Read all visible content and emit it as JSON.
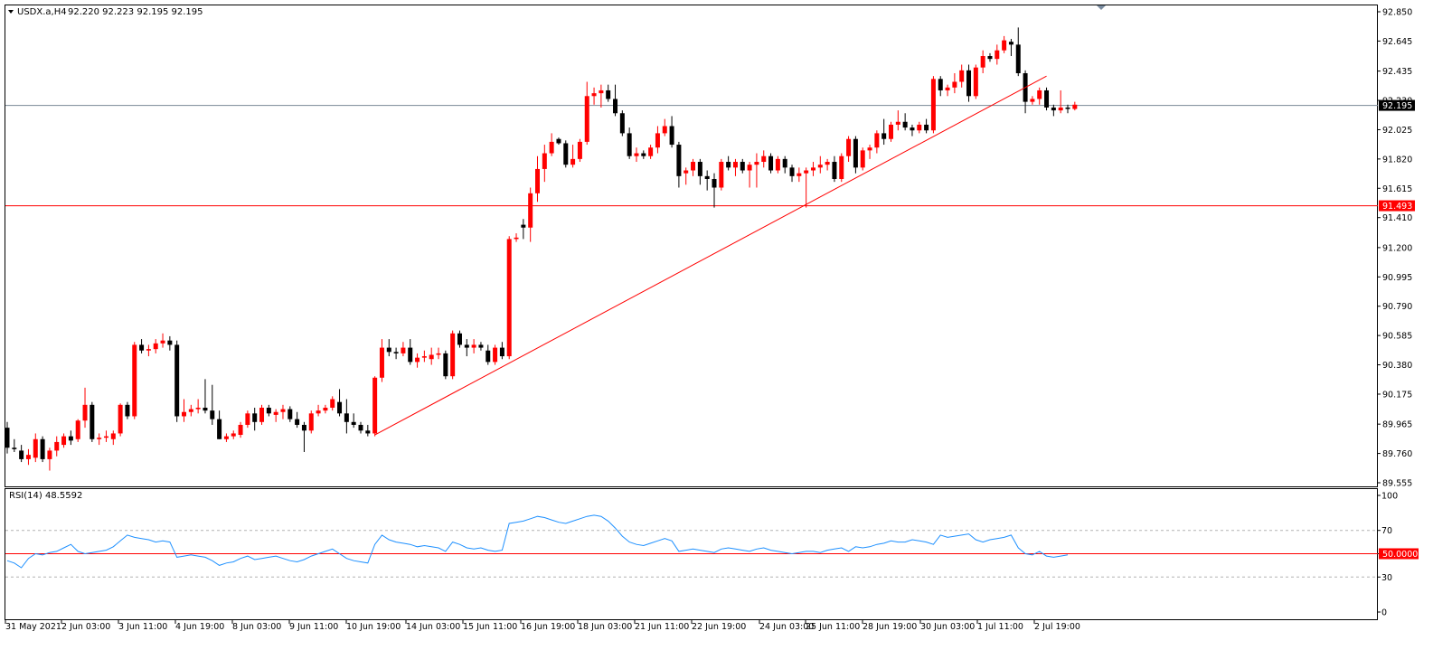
{
  "header": {
    "symbol_label": "USDX.a,H4",
    "ohlc": "92.220 92.223 92.195 92.195"
  },
  "rsi_header": {
    "label": "RSI(14) 48.5592"
  },
  "colors": {
    "bull": "#ff0000",
    "bear": "#000000",
    "trend": "#ff0000",
    "support": "#ff0000",
    "rsi_line": "#1e90ff",
    "rsi_level": "#ff0000",
    "bid_line": "#7a8896",
    "grid_dash": "#b4b4b4"
  },
  "chart_data": [
    {
      "type": "candlestick",
      "symbol": "USDX.a",
      "timeframe": "H4",
      "ylim": [
        89.555,
        92.85
      ],
      "y_ticks": [
        "92.850",
        "92.645",
        "92.435",
        "92.230",
        "92.025",
        "91.820",
        "91.615",
        "91.410",
        "91.200",
        "90.995",
        "90.790",
        "90.585",
        "90.380",
        "90.175",
        "89.965",
        "89.760",
        "89.555"
      ],
      "x_labels": [
        "31 May 2021",
        "2 Jun 03:00",
        "3 Jun 11:00",
        "4 Jun 19:00",
        "8 Jun 03:00",
        "9 Jun 11:00",
        "10 Jun 19:00",
        "14 Jun 03:00",
        "15 Jun 11:00",
        "16 Jun 19:00",
        "18 Jun 03:00",
        "21 Jun 11:00",
        "22 Jun 19:00",
        "24 Jun 03:00",
        "25 Jun 11:00",
        "28 Jun 19:00",
        "30 Jun 03:00",
        "1 Jul 11:00",
        "2 Jul 19:00"
      ],
      "current_price": "92.195",
      "support_level": "91.493",
      "ohlc": [
        [
          89.94,
          89.98,
          89.76,
          89.8
        ],
        [
          89.8,
          89.86,
          89.77,
          89.79
        ],
        [
          89.78,
          89.82,
          89.7,
          89.72
        ],
        [
          89.72,
          89.79,
          89.68,
          89.75
        ],
        [
          89.73,
          89.9,
          89.7,
          89.86
        ],
        [
          89.86,
          89.88,
          89.7,
          89.72
        ],
        [
          89.72,
          89.8,
          89.64,
          89.78
        ],
        [
          89.78,
          89.88,
          89.74,
          89.84
        ],
        [
          89.82,
          89.9,
          89.8,
          89.88
        ],
        [
          89.88,
          89.92,
          89.82,
          89.85
        ],
        [
          89.86,
          90.0,
          89.84,
          89.99
        ],
        [
          89.99,
          90.22,
          89.94,
          90.1
        ],
        [
          90.1,
          90.12,
          89.84,
          89.86
        ],
        [
          89.86,
          89.9,
          89.82,
          89.87
        ],
        [
          89.87,
          89.92,
          89.84,
          89.88
        ],
        [
          89.86,
          89.92,
          89.82,
          89.9
        ],
        [
          89.9,
          90.11,
          89.88,
          90.1
        ],
        [
          90.1,
          90.12,
          90.0,
          90.02
        ],
        [
          90.02,
          90.54,
          90.0,
          90.52
        ],
        [
          90.52,
          90.56,
          90.46,
          90.48
        ],
        [
          90.48,
          90.52,
          90.44,
          90.49
        ],
        [
          90.49,
          90.56,
          90.46,
          90.53
        ],
        [
          90.53,
          90.6,
          90.5,
          90.55
        ],
        [
          90.55,
          90.58,
          90.48,
          90.52
        ],
        [
          90.52,
          90.55,
          89.98,
          90.02
        ],
        [
          90.02,
          90.14,
          89.98,
          90.05
        ],
        [
          90.05,
          90.1,
          90.02,
          90.07
        ],
        [
          90.07,
          90.14,
          90.04,
          90.08
        ],
        [
          90.08,
          90.28,
          90.04,
          90.06
        ],
        [
          90.06,
          90.24,
          89.96,
          90.0
        ],
        [
          90.0,
          90.06,
          89.86,
          89.86
        ],
        [
          89.86,
          89.9,
          89.84,
          89.88
        ],
        [
          89.88,
          89.92,
          89.86,
          89.9
        ],
        [
          89.89,
          89.98,
          89.87,
          89.96
        ],
        [
          89.96,
          90.06,
          89.94,
          90.04
        ],
        [
          90.04,
          90.08,
          89.92,
          89.98
        ],
        [
          89.98,
          90.1,
          89.96,
          90.08
        ],
        [
          90.08,
          90.1,
          90.02,
          90.04
        ],
        [
          90.03,
          90.07,
          89.98,
          90.05
        ],
        [
          90.05,
          90.1,
          90.0,
          90.07
        ],
        [
          90.07,
          90.09,
          89.98,
          90.0
        ],
        [
          90.0,
          90.05,
          89.94,
          89.96
        ],
        [
          89.96,
          89.98,
          89.77,
          89.92
        ],
        [
          89.92,
          90.06,
          89.9,
          90.04
        ],
        [
          90.04,
          90.1,
          90.02,
          90.06
        ],
        [
          90.06,
          90.1,
          90.04,
          90.08
        ],
        [
          90.08,
          90.16,
          90.06,
          90.14
        ],
        [
          90.12,
          90.21,
          90.02,
          90.04
        ],
        [
          90.04,
          90.14,
          89.9,
          89.98
        ],
        [
          89.98,
          90.04,
          89.94,
          89.96
        ],
        [
          89.96,
          89.98,
          89.9,
          89.92
        ],
        [
          89.92,
          89.96,
          89.88,
          89.9
        ],
        [
          89.9,
          90.3,
          89.88,
          90.29
        ],
        [
          90.29,
          90.56,
          90.26,
          90.5
        ],
        [
          90.5,
          90.56,
          90.44,
          90.47
        ],
        [
          90.47,
          90.5,
          90.42,
          90.46
        ],
        [
          90.46,
          90.54,
          90.44,
          90.5
        ],
        [
          90.5,
          90.56,
          90.38,
          90.4
        ],
        [
          90.4,
          90.46,
          90.36,
          90.43
        ],
        [
          90.43,
          90.48,
          90.4,
          90.44
        ],
        [
          90.42,
          90.5,
          90.38,
          90.45
        ],
        [
          90.45,
          90.5,
          90.42,
          90.46
        ],
        [
          90.46,
          90.48,
          90.28,
          90.3
        ],
        [
          90.3,
          90.62,
          90.28,
          90.6
        ],
        [
          90.6,
          90.62,
          90.5,
          90.52
        ],
        [
          90.52,
          90.56,
          90.44,
          90.5
        ],
        [
          90.5,
          90.56,
          90.46,
          90.52
        ],
        [
          90.52,
          90.54,
          90.48,
          90.5
        ],
        [
          90.48,
          90.52,
          90.38,
          90.4
        ],
        [
          90.4,
          90.52,
          90.38,
          90.5
        ],
        [
          90.5,
          90.54,
          90.42,
          90.44
        ],
        [
          90.44,
          91.28,
          90.42,
          91.26
        ],
        [
          91.26,
          91.3,
          91.24,
          91.27
        ],
        [
          91.36,
          91.4,
          91.26,
          91.34
        ],
        [
          91.34,
          91.62,
          91.24,
          91.58
        ],
        [
          91.58,
          91.84,
          91.52,
          91.75
        ],
        [
          91.75,
          91.92,
          91.66,
          91.86
        ],
        [
          91.86,
          92.0,
          91.84,
          91.94
        ],
        [
          91.96,
          91.97,
          91.92,
          91.93
        ],
        [
          91.93,
          91.95,
          91.76,
          91.78
        ],
        [
          91.78,
          91.92,
          91.76,
          91.82
        ],
        [
          91.82,
          91.96,
          91.8,
          91.94
        ],
        [
          91.94,
          92.36,
          91.92,
          92.26
        ],
        [
          92.26,
          92.32,
          92.2,
          92.28
        ],
        [
          92.28,
          92.34,
          92.18,
          92.3
        ],
        [
          92.3,
          92.34,
          92.22,
          92.24
        ],
        [
          92.24,
          92.34,
          92.12,
          92.14
        ],
        [
          92.14,
          92.16,
          91.98,
          92.0
        ],
        [
          92.0,
          92.04,
          91.82,
          91.84
        ],
        [
          91.84,
          91.9,
          91.8,
          91.86
        ],
        [
          91.86,
          91.88,
          91.82,
          91.84
        ],
        [
          91.84,
          91.92,
          91.82,
          91.9
        ],
        [
          91.9,
          92.05,
          91.86,
          92.0
        ],
        [
          92.0,
          92.1,
          91.98,
          92.05
        ],
        [
          92.05,
          92.12,
          91.9,
          91.92
        ],
        [
          91.92,
          91.94,
          91.62,
          91.7
        ],
        [
          91.72,
          91.76,
          91.64,
          91.74
        ],
        [
          91.74,
          91.82,
          91.7,
          91.8
        ],
        [
          91.8,
          91.82,
          91.64,
          91.7
        ],
        [
          91.7,
          91.74,
          91.6,
          91.68
        ],
        [
          91.68,
          91.72,
          91.48,
          91.62
        ],
        [
          91.62,
          91.82,
          91.6,
          91.8
        ],
        [
          91.8,
          91.84,
          91.74,
          91.76
        ],
        [
          91.76,
          91.82,
          91.7,
          91.8
        ],
        [
          91.8,
          91.82,
          91.72,
          91.74
        ],
        [
          91.74,
          91.8,
          91.62,
          91.78
        ],
        [
          91.78,
          91.86,
          91.62,
          91.8
        ],
        [
          91.8,
          91.88,
          91.76,
          91.84
        ],
        [
          91.84,
          91.86,
          91.72,
          91.74
        ],
        [
          91.74,
          91.84,
          91.72,
          91.82
        ],
        [
          91.82,
          91.84,
          91.72,
          91.76
        ],
        [
          91.76,
          91.78,
          91.66,
          91.7
        ],
        [
          91.7,
          91.76,
          91.66,
          91.72
        ],
        [
          91.72,
          91.76,
          91.48,
          91.74
        ],
        [
          91.74,
          91.8,
          91.7,
          91.76
        ],
        [
          91.76,
          91.84,
          91.72,
          91.78
        ],
        [
          91.78,
          91.82,
          91.74,
          91.8
        ],
        [
          91.8,
          91.84,
          91.66,
          91.68
        ],
        [
          91.68,
          91.86,
          91.66,
          91.84
        ],
        [
          91.84,
          91.98,
          91.8,
          91.96
        ],
        [
          91.96,
          91.98,
          91.72,
          91.76
        ],
        [
          91.76,
          91.9,
          91.74,
          91.88
        ],
        [
          91.88,
          91.92,
          91.82,
          91.9
        ],
        [
          91.9,
          92.02,
          91.86,
          92.0
        ],
        [
          92.0,
          92.1,
          91.92,
          91.96
        ],
        [
          91.96,
          92.08,
          91.94,
          92.06
        ],
        [
          92.06,
          92.16,
          92.02,
          92.08
        ],
        [
          92.08,
          92.14,
          92.02,
          92.04
        ],
        [
          92.04,
          92.06,
          91.98,
          92.02
        ],
        [
          92.02,
          92.08,
          92.0,
          92.06
        ],
        [
          92.06,
          92.1,
          92.0,
          92.02
        ],
        [
          92.02,
          92.4,
          92.0,
          92.38
        ],
        [
          92.38,
          92.4,
          92.26,
          92.3
        ],
        [
          92.3,
          92.34,
          92.26,
          92.32
        ],
        [
          92.32,
          92.42,
          92.28,
          92.36
        ],
        [
          92.36,
          92.48,
          92.32,
          92.44
        ],
        [
          92.44,
          92.48,
          92.22,
          92.26
        ],
        [
          92.26,
          92.48,
          92.24,
          92.46
        ],
        [
          92.46,
          92.58,
          92.42,
          92.54
        ],
        [
          92.54,
          92.56,
          92.5,
          92.52
        ],
        [
          92.52,
          92.62,
          92.48,
          92.58
        ],
        [
          92.58,
          92.68,
          92.56,
          92.65
        ],
        [
          92.64,
          92.66,
          92.54,
          92.62
        ],
        [
          92.62,
          92.74,
          92.4,
          92.42
        ],
        [
          92.42,
          92.44,
          92.14,
          92.22
        ],
        [
          92.22,
          92.26,
          92.2,
          92.24
        ],
        [
          92.24,
          92.32,
          92.2,
          92.3
        ],
        [
          92.3,
          92.32,
          92.16,
          92.18
        ],
        [
          92.18,
          92.2,
          92.12,
          92.16
        ],
        [
          92.16,
          92.3,
          92.14,
          92.18
        ],
        [
          92.18,
          92.2,
          92.14,
          92.17
        ],
        [
          92.17,
          92.22,
          92.16,
          92.2
        ]
      ]
    },
    {
      "type": "line",
      "name": "RSI(14)",
      "current": "48.5592",
      "ylim": [
        0,
        100
      ],
      "y_ticks": [
        "100",
        "70",
        "50",
        "30",
        "0"
      ],
      "level_label": "50.0000",
      "values": [
        44,
        42,
        38,
        46,
        50,
        49,
        51,
        52,
        55,
        58,
        52,
        50,
        51,
        52,
        53,
        56,
        61,
        66,
        64,
        63,
        62,
        60,
        61,
        60,
        47,
        48,
        49,
        48,
        47,
        44,
        40,
        42,
        43,
        46,
        48,
        45,
        46,
        47,
        48,
        46,
        44,
        43,
        45,
        48,
        50,
        52,
        54,
        50,
        46,
        44,
        43,
        42,
        58,
        66,
        62,
        60,
        59,
        58,
        56,
        57,
        56,
        55,
        52,
        60,
        58,
        55,
        54,
        55,
        53,
        52,
        53,
        76,
        77,
        78,
        80,
        82,
        81,
        79,
        77,
        76,
        78,
        80,
        82,
        83,
        82,
        78,
        72,
        65,
        60,
        58,
        57,
        59,
        61,
        63,
        61,
        52,
        53,
        54,
        53,
        52,
        51,
        54,
        55,
        54,
        53,
        52,
        54,
        55,
        53,
        52,
        51,
        50,
        51,
        52,
        52,
        51,
        53,
        54,
        55,
        52,
        56,
        55,
        56,
        58,
        59,
        61,
        60,
        60,
        62,
        61,
        60,
        58,
        66,
        64,
        65,
        66,
        67,
        62,
        60,
        62,
        63,
        64,
        66,
        55,
        50,
        49,
        52,
        48,
        47,
        48,
        49
      ]
    }
  ]
}
